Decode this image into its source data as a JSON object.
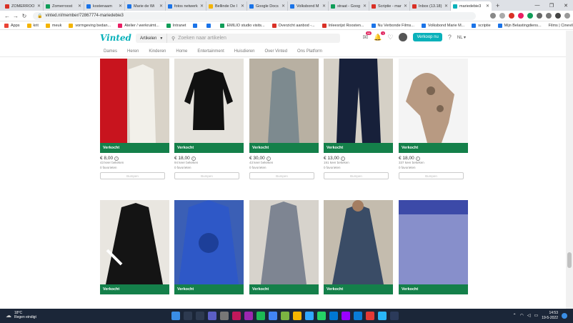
{
  "browser": {
    "tabs": [
      {
        "label": "ZOMERROO",
        "color": "#d93025"
      },
      {
        "label": "Zomerroost",
        "color": "#0f9d58"
      },
      {
        "label": "kostenaam",
        "color": "#1a73e8"
      },
      {
        "label": "Marie de Wi",
        "color": "#1a73e8"
      },
      {
        "label": "fotos netwerk",
        "color": "#1a73e8"
      },
      {
        "label": "Bellinde De l",
        "color": "#f4b400"
      },
      {
        "label": "Google Docs",
        "color": "#1a73e8"
      },
      {
        "label": "Volksbond M",
        "color": "#1a73e8"
      },
      {
        "label": "straat - Goog",
        "color": "#0f9d58"
      },
      {
        "label": "Scriptie - mar",
        "color": "#d93025"
      },
      {
        "label": "Inbox (13.18)",
        "color": "#d93025"
      },
      {
        "label": "mariedebie3",
        "color": "#09b1ba",
        "active": true
      }
    ],
    "new_tab": "+",
    "url": "vinted.nl/member/72867774-mariedebie3",
    "bookmarks": [
      {
        "label": "Apps",
        "color": "#ea4335"
      },
      {
        "label": "krit",
        "color": "#f4b400"
      },
      {
        "label": "meuk",
        "color": "#f4b400"
      },
      {
        "label": "vormgeving bedan...",
        "color": "#f4b400"
      },
      {
        "label": "Atelier / werkruimt...",
        "color": "#e91e63"
      },
      {
        "label": "Intranet",
        "color": "#0f9d58"
      },
      {
        "label": "",
        "color": "#1a73e8"
      },
      {
        "label": "",
        "color": "#1a73e8"
      },
      {
        "label": "EMILIO studio visits...",
        "color": "#0f9d58"
      },
      {
        "label": "Overzicht aanbod -...",
        "color": "#d93025"
      },
      {
        "label": "Inleesrijst Roosten...",
        "color": "#d93025"
      },
      {
        "label": "Nu Verbonde Films...",
        "color": "#1a73e8"
      },
      {
        "label": "Volksbond Marie M...",
        "color": "#1a73e8"
      },
      {
        "label": "scriptie",
        "color": "#1a73e8"
      },
      {
        "label": "Mijn Belastingdiens...",
        "color": "#1a73e8"
      }
    ],
    "bookmarks_right": "Films | Cineville Villa..."
  },
  "header": {
    "logo": "Vinted",
    "category_select": "Artikelen",
    "search_placeholder": "Zoeken naar artikelen",
    "inbox_badge": "99",
    "notif_badge": "1",
    "sell_button": "Verkoop nu",
    "language": "NL"
  },
  "catnav": [
    "Dames",
    "Heren",
    "Kinderen",
    "Home",
    "Entertainment",
    "Huisdieren",
    "Over Vinted",
    "Ons Platform"
  ],
  "items": [
    {
      "price": "€ 8,00",
      "views": "43 keer bekeken",
      "favs": "0 favorieten",
      "bg": "#d9d3c8"
    },
    {
      "price": "€ 18,00",
      "views": "94 keer bekeken",
      "favs": "0 favorieten",
      "bg": "#e5e2dc"
    },
    {
      "price": "€ 30,00",
      "views": "43 keer bekeken",
      "favs": "0 favorieten",
      "bg": "#c9c2b7"
    },
    {
      "price": "€ 13,00",
      "views": "191 keer bekeken",
      "favs": "0 favorieten",
      "bg": "#d5d0c6"
    },
    {
      "price": "€ 18,00",
      "views": "337 keer bekeken",
      "favs": "0 favorieten",
      "bg": "#f4f4f4"
    },
    {
      "price": "",
      "views": "",
      "favs": "",
      "bg": "#e9e6e0"
    },
    {
      "price": "",
      "views": "",
      "favs": "",
      "bg": "#3b5fb5"
    },
    {
      "price": "",
      "views": "",
      "favs": "",
      "bg": "#d7d3cc"
    },
    {
      "price": "",
      "views": "",
      "favs": "",
      "bg": "#c4bcae"
    },
    {
      "price": "",
      "views": "",
      "favs": "",
      "bg": "#d7d2c8"
    }
  ],
  "sold_label": "Verkocht",
  "bump_label": "Bumpen",
  "info_glyph": "i",
  "taskbar": {
    "temp": "18°C",
    "weather": "Regen eindigt",
    "time": "14:53",
    "date": "19-5-2022"
  }
}
